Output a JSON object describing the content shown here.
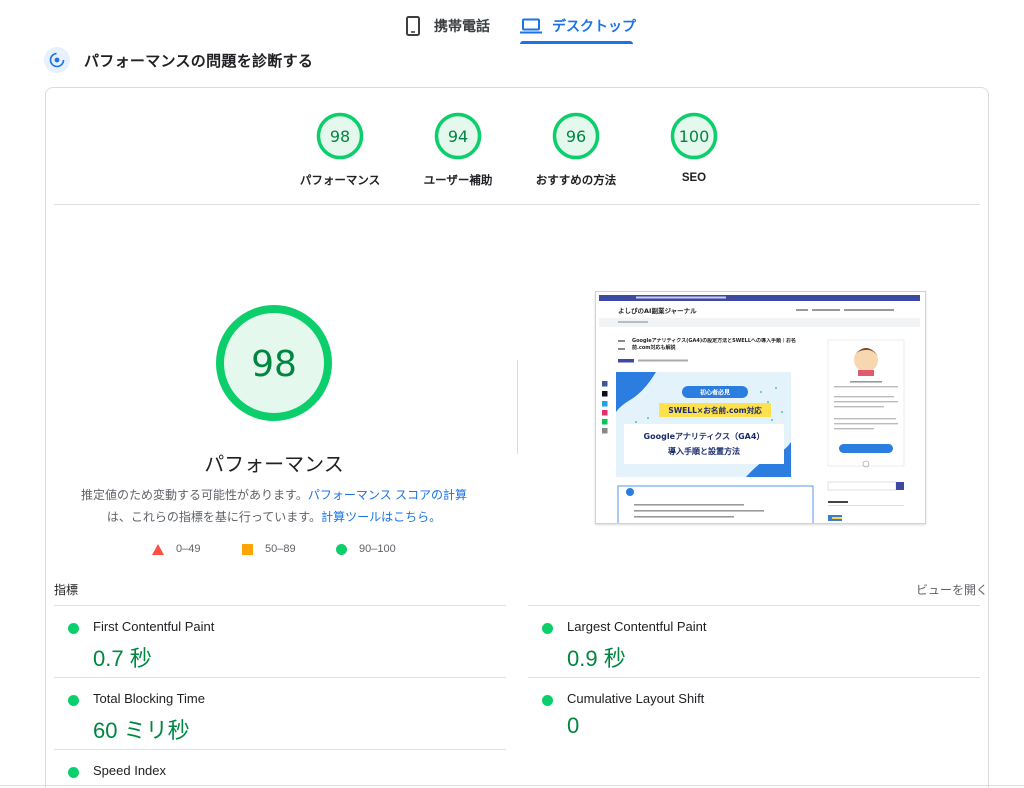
{
  "tabs": {
    "mobile_label": "携帯電話",
    "desktop_label": "デスクトップ",
    "active": "desktop"
  },
  "section": {
    "title": "パフォーマンスの問題を診断する"
  },
  "colors": {
    "pass": "#0cce6b",
    "pass_text": "#018642",
    "pass_fill": "#e5f8ed",
    "average": "#ffa400",
    "fail": "#ff4e42",
    "link": "#1a73e8"
  },
  "scores": [
    {
      "label": "パフォーマンス",
      "value": "98"
    },
    {
      "label": "ユーザー補助",
      "value": "94"
    },
    {
      "label": "おすすめの方法",
      "value": "96"
    },
    {
      "label": "SEO",
      "value": "100"
    }
  ],
  "performance": {
    "score": "98",
    "label": "パフォーマンス",
    "note_part1": "推定値のため変動する可能性があります。",
    "note_link1": "パフォーマンス スコアの計算",
    "note_part2": "は、これらの指標を基に行っています。",
    "note_link2": "計算ツールはこちら。"
  },
  "legend": [
    {
      "shape": "triangle",
      "range": "0–49"
    },
    {
      "shape": "square",
      "range": "50–89"
    },
    {
      "shape": "circle",
      "range": "90–100"
    }
  ],
  "metrics_section": {
    "title": "指標",
    "expand_label": "ビューを開く"
  },
  "metrics": [
    {
      "name": "First Contentful Paint",
      "value": "0.7 秒"
    },
    {
      "name": "Largest Contentful Paint",
      "value": "0.9 秒"
    },
    {
      "name": "Total Blocking Time",
      "value": "60 ミリ秒"
    },
    {
      "name": "Cumulative Layout Shift",
      "value": "0"
    },
    {
      "name": "Speed Index",
      "value": ""
    }
  ],
  "thumbnail": {
    "site_name": "よしぴのAI副業ジャーナル",
    "article_title": "Googleアナリティクス(GA4)の設定方法とSWELLへの導入手順｜お名前.com対応も解説",
    "hero_badge": "初心者必見",
    "hero_line1": "SWELL×お名前.com対応",
    "hero_line2": "Googleアナリティクス（GA4）",
    "hero_line3": "導入手順と設置方法"
  }
}
